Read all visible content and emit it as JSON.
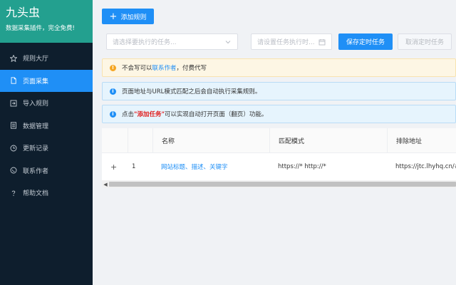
{
  "brand": {
    "title": "九头虫",
    "subtitle": "数据采集插件，完全免费!"
  },
  "nav": [
    {
      "label": "规则大厅",
      "icon": "star-icon",
      "active": false
    },
    {
      "label": "页面采集",
      "icon": "document-icon",
      "active": true
    },
    {
      "label": "导入规则",
      "icon": "import-icon",
      "active": false
    },
    {
      "label": "数据管理",
      "icon": "data-icon",
      "active": false
    },
    {
      "label": "更新记录",
      "icon": "clock-icon",
      "active": false
    },
    {
      "label": "联系作者",
      "icon": "chat-icon",
      "active": false
    },
    {
      "label": "帮助文档",
      "icon": "question-icon",
      "active": false
    }
  ],
  "toolbar": {
    "add_rule_label": "添加规则"
  },
  "filters": {
    "task_select_placeholder": "请选择要执行的任务...",
    "time_placeholder": "请设置任务执行时...",
    "save_label": "保存定时任务",
    "cancel_label": "取消定时任务"
  },
  "alerts": {
    "warn_prefix": "不会写可以",
    "warn_link": "联系作者",
    "warn_suffix": "，付费代写",
    "info1": "页面地址与URL模式匹配之后会自动执行采集规则。",
    "info2_prefix": "点击",
    "info2_highlight": "\"添加任务\"",
    "info2_suffix": "可以实现自动打开页面（翻页）功能。"
  },
  "table": {
    "columns": [
      "名称",
      "匹配模式",
      "排除地址"
    ],
    "rows": [
      {
        "expand": "+",
        "index": "1",
        "name": "网站标题、描述、关键字",
        "match": "https://* http://*",
        "exclude": "https://jtc.lhyhq.cn/#/"
      }
    ]
  },
  "colors": {
    "brand_bg": "#23a08f",
    "sidebar_bg": "#0e1e2d",
    "accent": "#1f8ff6",
    "warn": "#f5a623",
    "highlight_red": "#e02020"
  }
}
